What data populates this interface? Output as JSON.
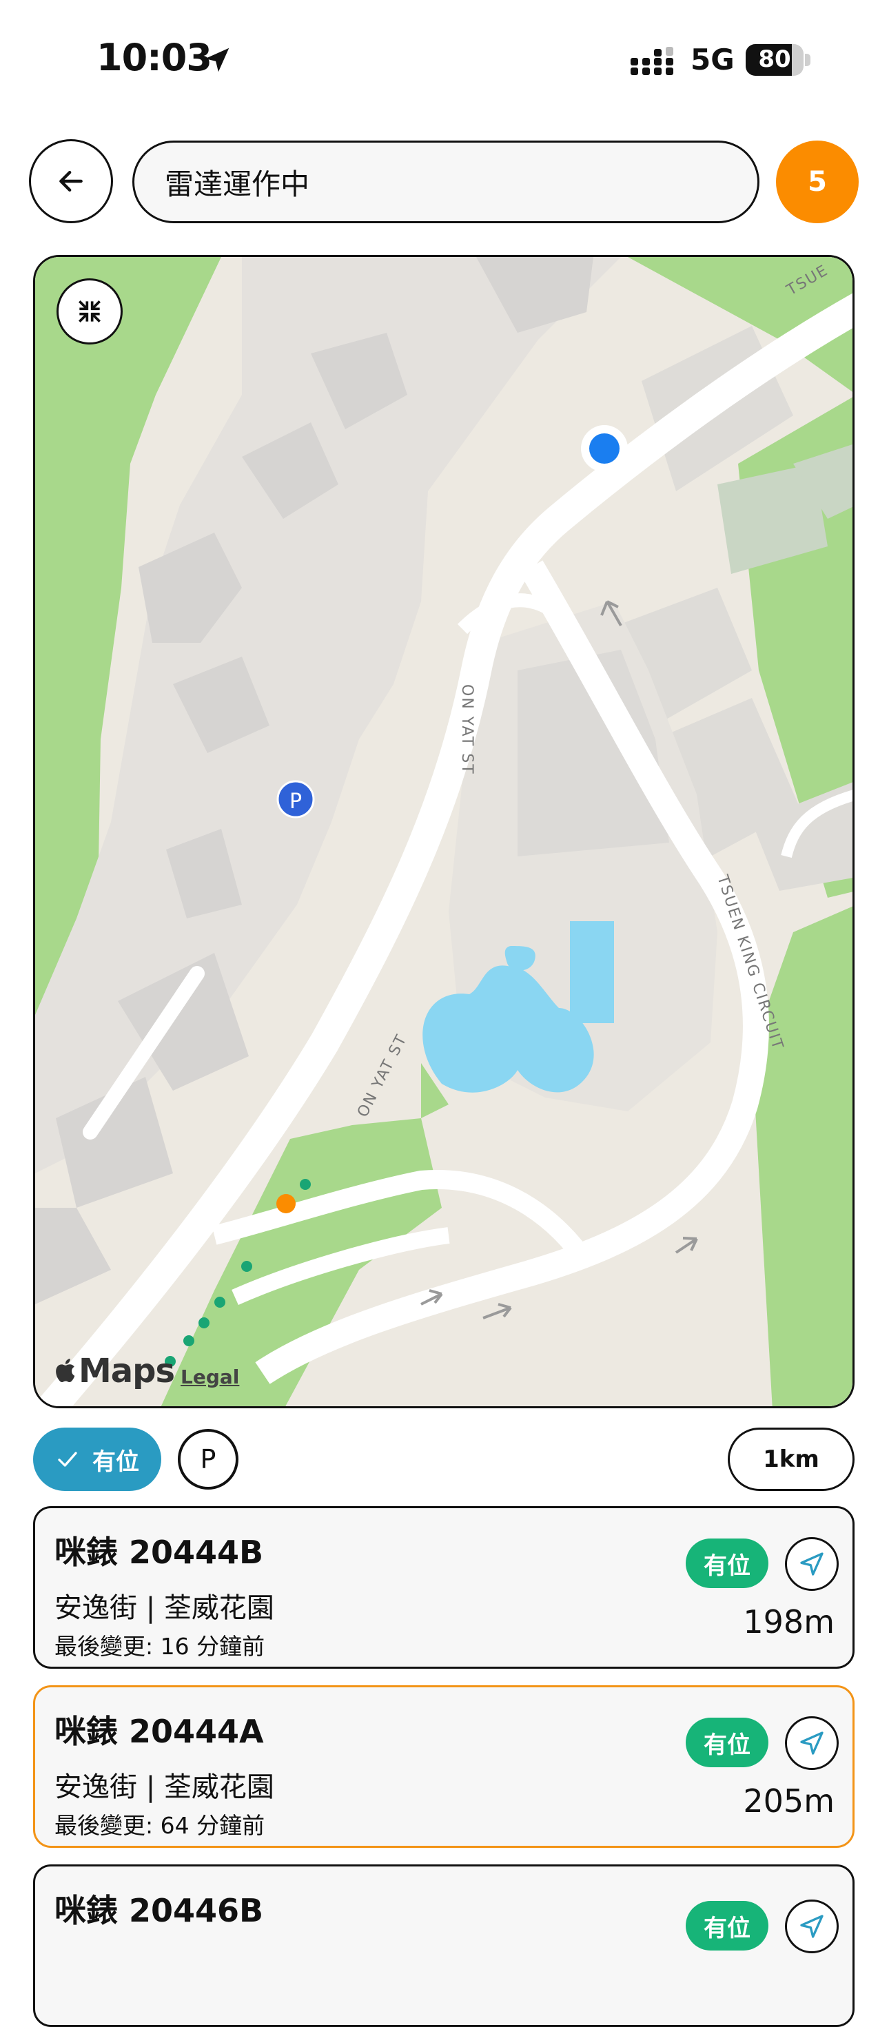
{
  "status_bar": {
    "time": "10:03",
    "network": "5G",
    "battery": "80",
    "battery_level": 0.8
  },
  "header": {
    "status_text": "雷達運作中",
    "result_count": "5"
  },
  "map": {
    "brand": "Maps",
    "legal": "Legal",
    "parking_marker": "P",
    "street_labels": [
      "ON YAT ST",
      "ON YAT ST",
      "TSUEN KING CIRCUIT",
      "TSUE"
    ]
  },
  "filters": {
    "vacant_label": "有位",
    "parking_label": "P",
    "range_label": "1km"
  },
  "meters": [
    {
      "title": "咪錶 20444B",
      "address": "安逸街 | 荃威花園",
      "updated": "最後變更: 16 分鐘前",
      "status": "有位",
      "distance": "198m"
    },
    {
      "title": "咪錶 20444A",
      "address": "安逸街 | 荃威花園",
      "updated": "最後變更: 64 分鐘前",
      "status": "有位",
      "distance": "205m"
    },
    {
      "title": "咪錶 20446B",
      "address": "",
      "updated": "",
      "status": "有位",
      "distance": ""
    }
  ],
  "colors": {
    "accent_orange": "#fb8c00",
    "accent_blue": "#2a9bc2",
    "status_green": "#17b478",
    "location_blue": "#1a7ef0"
  },
  "icons": [
    "location-arrow-icon",
    "signal-icon",
    "battery-icon",
    "back-arrow-icon",
    "collapse-icon",
    "apple-logo-icon",
    "checkmark-icon",
    "navigation-arrow-icon"
  ]
}
